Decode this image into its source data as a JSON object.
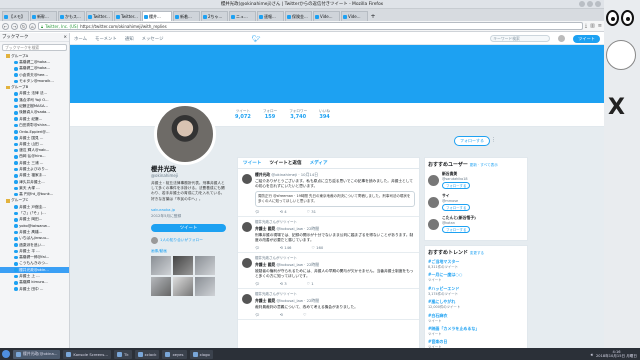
{
  "window": {
    "title": "櫻井光政(@okinahimeji)さん | Twitterからの返信付きツイート - Mozilla Firefox"
  },
  "tabs": [
    {
      "label": "【メモ】"
    },
    {
      "label": "新幹..."
    },
    {
      "label": "かもス..."
    },
    {
      "label": "Twitter..."
    },
    {
      "label": "Twitter..."
    },
    {
      "label": "櫻井..."
    },
    {
      "label": "新着..."
    },
    {
      "label": "2ちゃ..."
    },
    {
      "label": "ニュ..."
    },
    {
      "label": "速報..."
    },
    {
      "label": "保険金..."
    },
    {
      "label": "Vide..."
    },
    {
      "label": "Vide..."
    }
  ],
  "nav": {
    "cert": "Twitter, Inc. (US)",
    "url": "https://twitter.com/okinahimeji/with_replies"
  },
  "sidebar": {
    "title": "ブックマーク",
    "search_placeholder": "ブックマークを検索",
    "items": [
      {
        "label": "グループA",
        "folder": true
      },
      {
        "label": "高橋健二@hoka..."
      },
      {
        "label": "高橋健二@hoka..."
      },
      {
        "label": "小倉秀夫@hee..."
      },
      {
        "label": "モキタン@moraik..."
      },
      {
        "label": "グループB",
        "folder": true
      },
      {
        "label": "弁護士 法律 法..."
      },
      {
        "label": "落合洋司 Yoji O..."
      },
      {
        "label": "紀藤正樹MASA..."
      },
      {
        "label": "後藤貞人@sada..."
      },
      {
        "label": "弁護士 紀藤..."
      },
      {
        "label": "白田秀彰@shira..."
      },
      {
        "label": "Ordo-Eppieri@..."
      },
      {
        "label": "弁護士 国見 ..."
      },
      {
        "label": "弁護士 山田 ..."
      },
      {
        "label": "渡辺 輝人@nab..."
      },
      {
        "label": "西岡 弘@hiro..."
      },
      {
        "label": "弁護士 三浦 ..."
      },
      {
        "label": "弁護士よびのり..."
      },
      {
        "label": "弁護士 福家ま..."
      },
      {
        "label": "津久井弁護士..."
      },
      {
        "label": "楽天 大塚 ..."
      },
      {
        "label": "高 円@ht_@bunk..."
      },
      {
        "label": "グループC",
        "folder": true
      },
      {
        "label": "弁護士 戸舘圭..."
      },
      {
        "label": "「さ」(「そ」(..."
      },
      {
        "label": "弁護士 岡田..."
      },
      {
        "label": "yoko@taiwanw..."
      },
      {
        "label": "弁護士 髙橋..."
      },
      {
        "label": "いちばんjinwuu..."
      },
      {
        "label": "過激派を追い..."
      },
      {
        "label": "弁護士 平 ..."
      },
      {
        "label": "高橋健一郎@fal..."
      },
      {
        "label": "こうもんきのつ..."
      },
      {
        "label": "櫻井光政@okin...",
        "selected": true
      },
      {
        "label": "弁護士 上 ..."
      },
      {
        "label": "高橋輝 kimura..."
      },
      {
        "label": "弁護士 田中 ..."
      }
    ]
  },
  "twitter_nav": {
    "home": "ホーム",
    "moments": "モーメント",
    "notifications": "通知",
    "messages": "メッセージ",
    "search_placeholder": "キーワード検索",
    "tweet": "ツイート"
  },
  "stats": [
    {
      "label": "ツイート",
      "value": "9,072"
    },
    {
      "label": "フォロー",
      "value": "159"
    },
    {
      "label": "フォロワー",
      "value": "3,740"
    },
    {
      "label": "いいね",
      "value": "394"
    }
  ],
  "follow_button": "フォローする",
  "profile": {
    "name": "櫻井光政",
    "handle": "@okinahimeji",
    "bio": "弁護士・桜丘法律事務所代表。刑事弁護人として多くの事件を手掛ける。法曹養成にも関わり、若手弁護士の育成に力を入れている。好きな言葉は「市民の中へ」。",
    "link": "sakuraoka.jp",
    "joined": "2012年5月に登録",
    "tweet_to": "ツイート",
    "mutual": "1人の知り合いがフォロー",
    "media": "画像/動画"
  },
  "feed": {
    "tabs": [
      "ツイート",
      "ツイートと返信",
      "メディア"
    ],
    "tweets": [
      {
        "context": "",
        "name": "櫻井光政",
        "handle": "@okinahimeji · 10月14日",
        "text": "ご紹介ありがとうございます。私も原点に立ち返る思いでこの記事を読みました。弁護士としての初心を忘れずにいたいと思います。",
        "quote": "周防正行 @sfreeman · 19時間\n先日の東京地裁の判決について寄稿しました。刑事司法の現状を多くの人に知ってほしいと思います。",
        "replies": "",
        "retweets": "4",
        "likes": "31"
      },
      {
        "context": "櫻井光政さんがリツイート",
        "name": "弁護士 國見",
        "handle": "@kokusai_law · 22時間",
        "text": "刑事弁護の現場では、記録の開示が十分でないまま公判に臨まざるを得ないことがあります。制度の改善が必要だと感じています。",
        "quote": "",
        "replies": "",
        "retweets": "146",
        "likes": "160"
      },
      {
        "context": "櫻井光政さんがリツイート",
        "name": "弁護士 國見",
        "handle": "@kokusai_law · 22時間",
        "text": "被疑者の権利が守られるためには、弁護人の早期の関与が欠かせません。当番弁護士制度をもっと多くの方に知ってほしいです。",
        "quote": "",
        "replies": "",
        "retweets": "3",
        "likes": "1"
      },
      {
        "context": "櫻井光政さんがリツイート",
        "name": "弁護士 國見",
        "handle": "@kokusai_law · 22時間",
        "text": "裁判員裁判の意義について、改めて考える機会がありました。",
        "quote": "",
        "replies": "",
        "retweets": "",
        "likes": ""
      }
    ]
  },
  "suggestions": {
    "title": "おすすめユーザー",
    "refresh": "更新 · すべて表示",
    "users": [
      {
        "name": "新谷貴美",
        "handle": "@sarutahiko18",
        "follow": "フォローする"
      },
      {
        "name": "サイ",
        "handle": "@mrnose",
        "follow": "フォローする"
      },
      {
        "name": "こたんと(新谷悟子)",
        "handle": "@kotan",
        "follow": "フォローする"
      }
    ]
  },
  "trends": {
    "title": "おすすめトレンド",
    "change": "変更する",
    "items": [
      {
        "tag": "#ご当地マスター",
        "desc": "8,311件のツイート"
      },
      {
        "tag": "#一月に一度は○○",
        "desc": "ツイート"
      },
      {
        "tag": "#ハッピーエンド",
        "desc": "3,174件のツイート"
      },
      {
        "tag": "#嵐にしやがれ",
        "desc": "12,000件のツイート"
      },
      {
        "tag": "#白石麻衣",
        "desc": "ツイート"
      },
      {
        "tag": "#映画「カメラを止めるな」",
        "desc": "ツイート"
      },
      {
        "tag": "#音楽の日",
        "desc": "ツイート"
      }
    ]
  },
  "taskbar": {
    "items": [
      {
        "label": "櫻井光政(@okina..."
      },
      {
        "label": "Konsole Screens..."
      },
      {
        "label": "Tk"
      },
      {
        "label": "xclock"
      },
      {
        "label": "xeyes"
      },
      {
        "label": "xlogo"
      }
    ],
    "time": "4:16",
    "date": "2018年10月15日 月曜日"
  }
}
